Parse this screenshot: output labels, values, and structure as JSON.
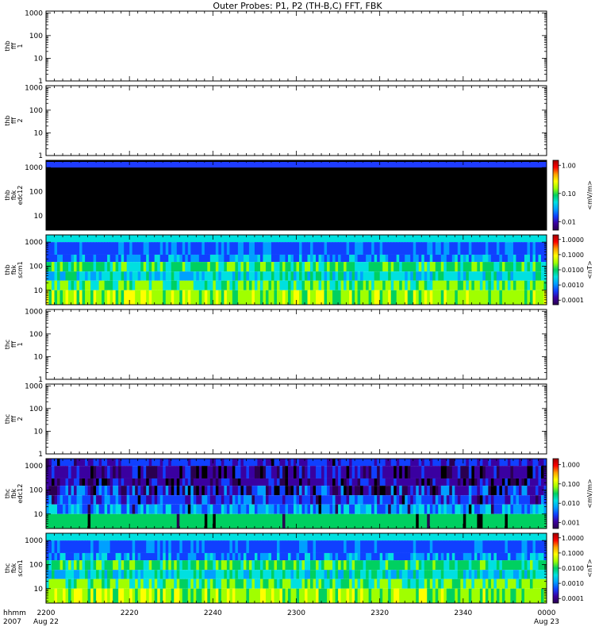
{
  "title": "Outer Probes: P1, P2 (TH-B,C) FFT, FBK",
  "x_axis": {
    "corner_label_top": "hhmm",
    "corner_label_bottom": "2007",
    "ticks": [
      {
        "label": "2200",
        "sub": "Aug 22",
        "minutes": 0
      },
      {
        "label": "2220",
        "sub": "",
        "minutes": 20
      },
      {
        "label": "2240",
        "sub": "",
        "minutes": 40
      },
      {
        "label": "2300",
        "sub": "",
        "minutes": 60
      },
      {
        "label": "2320",
        "sub": "",
        "minutes": 80
      },
      {
        "label": "2340",
        "sub": "",
        "minutes": 100
      },
      {
        "label": "0000",
        "sub": "Aug 23",
        "minutes": 120
      }
    ],
    "range_minutes": [
      0,
      120
    ]
  },
  "chart_data": [
    {
      "type": "heatmap",
      "ylabel": [
        "thb",
        "fff",
        "1"
      ],
      "yscale": "log",
      "ylim": [
        1,
        1200
      ],
      "yticks": [
        "1",
        "10",
        "100",
        "1000"
      ],
      "empty": true
    },
    {
      "type": "heatmap",
      "ylabel": [
        "thb",
        "fff",
        "2"
      ],
      "yscale": "log",
      "ylim": [
        1,
        1200
      ],
      "yticks": [
        "1",
        "10",
        "100",
        "1000"
      ],
      "empty": true
    },
    {
      "type": "heatmap",
      "ylabel": [
        "thb",
        "fbk",
        "edc12"
      ],
      "yscale": "log",
      "ylim": [
        2.5,
        2000
      ],
      "yticks": [
        "10",
        "100",
        "1000"
      ],
      "pattern": "dark",
      "colorbar": {
        "label": "<mV/m>",
        "ticks": [
          "0.01",
          "0.10",
          "1.00"
        ],
        "range": [
          0.005,
          1.5
        ]
      }
    },
    {
      "type": "heatmap",
      "ylabel": [
        "thb",
        "fbk",
        "scm1"
      ],
      "yscale": "log",
      "ylim": [
        2.5,
        2000
      ],
      "yticks": [
        "10",
        "100",
        "1000"
      ],
      "pattern": "scm",
      "colorbar": {
        "label": "<nT>",
        "ticks": [
          "0.0001",
          "0.0010",
          "0.0100",
          "0.1000",
          "1.0000"
        ],
        "range": [
          5e-05,
          2
        ]
      }
    },
    {
      "type": "heatmap",
      "ylabel": [
        "thc",
        "fff",
        "1"
      ],
      "yscale": "log",
      "ylim": [
        1,
        1200
      ],
      "yticks": [
        "1",
        "10",
        "100",
        "1000"
      ],
      "empty": true
    },
    {
      "type": "heatmap",
      "ylabel": [
        "thc",
        "fff",
        "2"
      ],
      "yscale": "log",
      "ylim": [
        1,
        1200
      ],
      "yticks": [
        "1",
        "10",
        "100",
        "1000"
      ],
      "empty": true
    },
    {
      "type": "heatmap",
      "ylabel": [
        "thc",
        "fbk",
        "edc12"
      ],
      "yscale": "log",
      "ylim": [
        2.5,
        2000
      ],
      "yticks": [
        "10",
        "100",
        "1000"
      ],
      "pattern": "edc",
      "colorbar": {
        "label": "<mV/m>",
        "ticks": [
          "0.001",
          "0.010",
          "0.100",
          "1.000"
        ],
        "range": [
          0.0005,
          2
        ]
      }
    },
    {
      "type": "heatmap",
      "ylabel": [
        "thc",
        "fbk",
        "scm1"
      ],
      "yscale": "log",
      "ylim": [
        2.5,
        2000
      ],
      "yticks": [
        "10",
        "100",
        "1000"
      ],
      "pattern": "scm",
      "colorbar": {
        "label": "<nT>",
        "ticks": [
          "0.0001",
          "0.0010",
          "0.0100",
          "0.1000",
          "1.0000"
        ],
        "range": [
          5e-05,
          2
        ]
      }
    }
  ],
  "palette": {
    "colorscale": [
      "#2a0050",
      "#3a00a0",
      "#1040ff",
      "#00a0ff",
      "#00e0e0",
      "#00d060",
      "#a0ff00",
      "#ffff00",
      "#ffa000",
      "#ff0000",
      "#a00000"
    ]
  }
}
